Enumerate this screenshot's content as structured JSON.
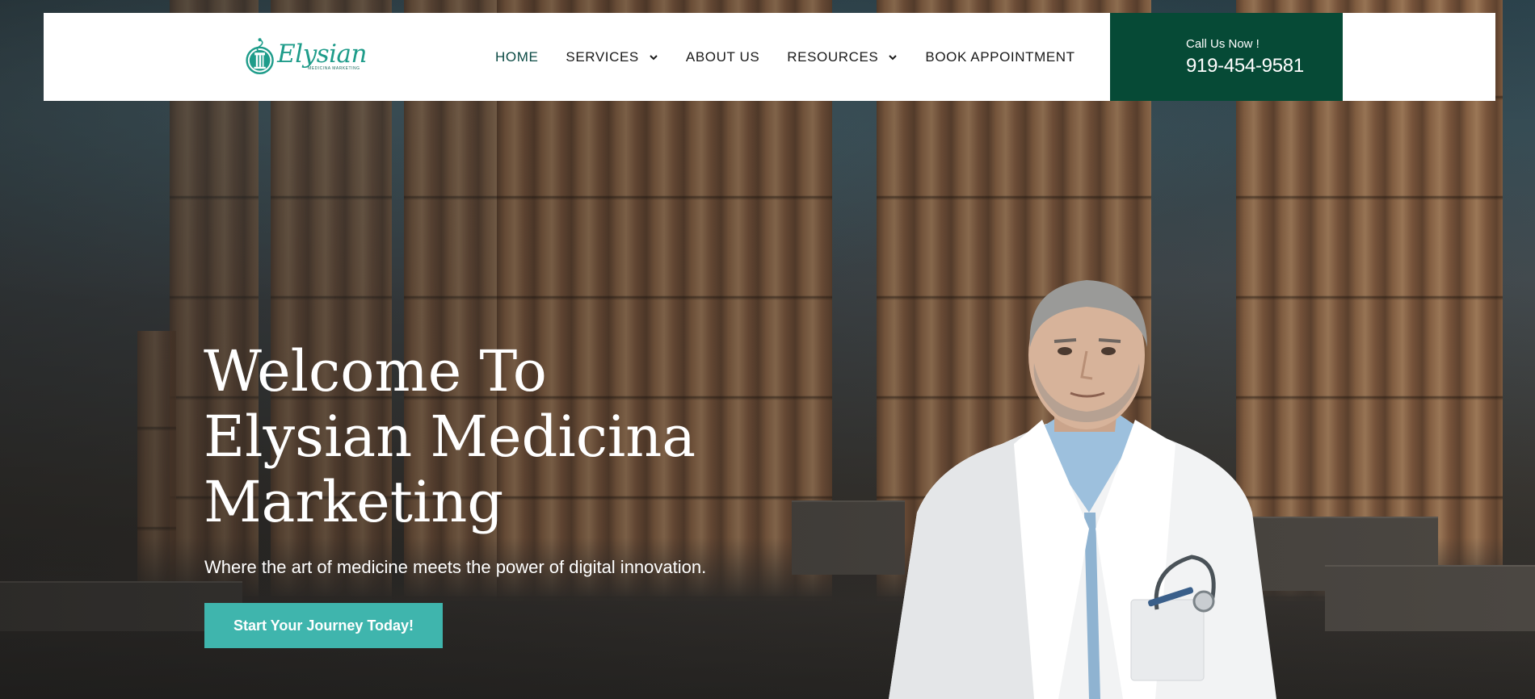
{
  "header": {
    "logo": {
      "word": "Elysian",
      "tagline": "MEDICINA MARKETING"
    },
    "nav": [
      {
        "label": "HOME",
        "active": true,
        "has_dropdown": false
      },
      {
        "label": "SERVICES",
        "active": false,
        "has_dropdown": true
      },
      {
        "label": "ABOUT US",
        "active": false,
        "has_dropdown": false
      },
      {
        "label": "RESOURCES",
        "active": false,
        "has_dropdown": true
      },
      {
        "label": "BOOK APPOINTMENT",
        "active": false,
        "has_dropdown": false
      }
    ],
    "call": {
      "label": "Call Us Now !",
      "phone": "919-454-9581"
    }
  },
  "hero": {
    "headline_lines": [
      "Welcome To",
      "Elysian Medicina",
      "Marketing"
    ],
    "subline": "Where the art of medicine meets the power of digital innovation.",
    "cta_label": "Start Your Journey Today!"
  },
  "colors": {
    "brand_teal": "#1e9c8a",
    "call_bg": "#064a36",
    "cta_bg": "#3fb5ad",
    "nav_active": "#0b4a44"
  },
  "icons": {
    "logo": "caduceus-column-logo-icon",
    "dropdown": "chevron-down-icon"
  }
}
